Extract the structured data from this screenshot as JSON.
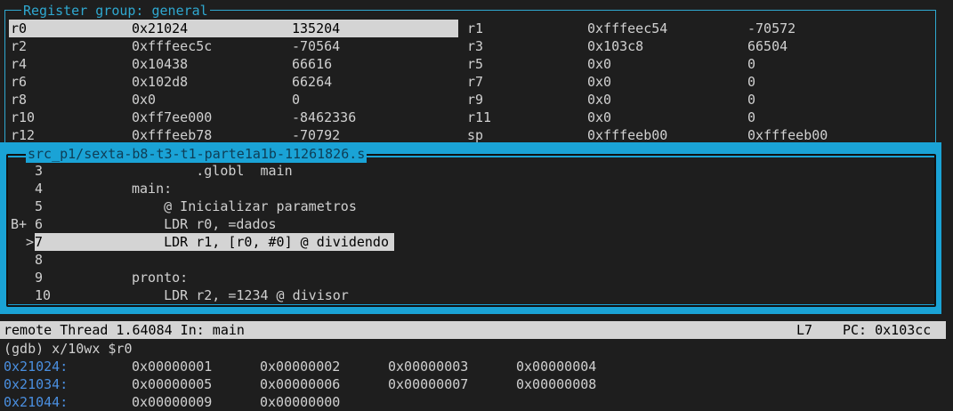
{
  "registers": {
    "title": "Register group: general",
    "left": [
      {
        "name": "r0",
        "hex": "0x21024",
        "dec": "135204"
      },
      {
        "name": "r2",
        "hex": "0xfffeec5c",
        "dec": "-70564"
      },
      {
        "name": "r4",
        "hex": "0x10438",
        "dec": "66616"
      },
      {
        "name": "r6",
        "hex": "0x102d8",
        "dec": "66264"
      },
      {
        "name": "r8",
        "hex": "0x0",
        "dec": "0"
      },
      {
        "name": "r10",
        "hex": "0xff7ee000",
        "dec": "-8462336"
      },
      {
        "name": "r12",
        "hex": "0xfffeeb78",
        "dec": "-70792"
      }
    ],
    "right": [
      {
        "name": "r1",
        "hex": "0xfffeec54",
        "dec": "-70572"
      },
      {
        "name": "r3",
        "hex": "0x103c8",
        "dec": "66504"
      },
      {
        "name": "r5",
        "hex": "0x0",
        "dec": "0"
      },
      {
        "name": "r7",
        "hex": "0x0",
        "dec": "0"
      },
      {
        "name": "r9",
        "hex": "0x0",
        "dec": "0"
      },
      {
        "name": "r11",
        "hex": "0x0",
        "dec": "0"
      },
      {
        "name": "sp",
        "hex": "0xfffeeb00",
        "dec": "0xfffeeb00"
      }
    ]
  },
  "source": {
    "title": "src_p1/sexta-b8-t3-t1-parte1a1b-11261826.s",
    "lines": [
      {
        "marker": "",
        "num": "3",
        "code": "        .globl  main"
      },
      {
        "marker": "",
        "num": "4",
        "code": "main:"
      },
      {
        "marker": "",
        "num": "5",
        "code": "    @ Inicializar parametros"
      },
      {
        "marker": "B+",
        "num": "6",
        "code": "    LDR r0, =dados"
      },
      {
        "marker": ">",
        "num": "7",
        "code": "    LDR r1, [r0, #0] @ dividendo"
      },
      {
        "marker": "",
        "num": "8",
        "code": ""
      },
      {
        "marker": "",
        "num": "9",
        "code": "pronto:"
      },
      {
        "marker": "",
        "num": "10",
        "code": "    LDR r2, =1234 @ divisor"
      }
    ]
  },
  "status": {
    "thread": "remote Thread 1.64084 In: main",
    "line": "L7",
    "pc": "PC: 0x103cc"
  },
  "console": {
    "command": "(gdb) x/10wx $r0",
    "rows": [
      {
        "addr": "0x21024:",
        "words": [
          "0x00000001",
          "0x00000002",
          "0x00000003",
          "0x00000004"
        ]
      },
      {
        "addr": "0x21034:",
        "words": [
          "0x00000005",
          "0x00000006",
          "0x00000007",
          "0x00000008"
        ]
      },
      {
        "addr": "0x21044:",
        "words": [
          "0x00000009",
          "0x00000000"
        ]
      }
    ]
  }
}
